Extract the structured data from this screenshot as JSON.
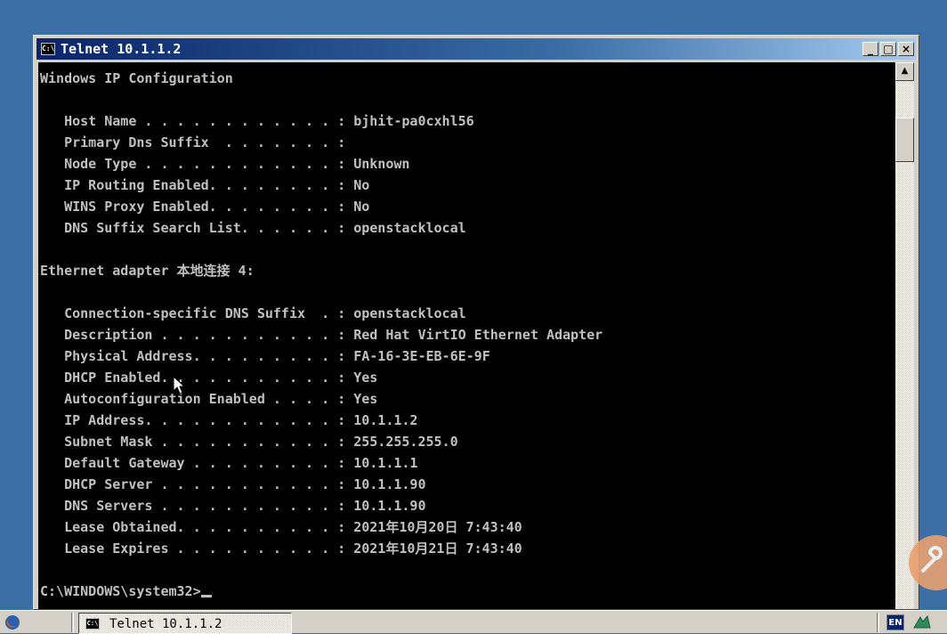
{
  "window": {
    "title": "Telnet 10.1.1.2",
    "icon_text": "C:\\",
    "minimize_glyph": "_",
    "maximize_glyph": "□",
    "close_glyph": "×"
  },
  "console": {
    "lines": [
      "Windows IP Configuration",
      "",
      "   Host Name . . . . . . . . . . . . : bjhit-pa0cxhl56",
      "   Primary Dns Suffix  . . . . . . . :",
      "   Node Type . . . . . . . . . . . . : Unknown",
      "   IP Routing Enabled. . . . . . . . : No",
      "   WINS Proxy Enabled. . . . . . . . : No",
      "   DNS Suffix Search List. . . . . . : openstacklocal",
      "",
      "Ethernet adapter 本地连接 4:",
      "",
      "   Connection-specific DNS Suffix  . : openstacklocal",
      "   Description . . . . . . . . . . . : Red Hat VirtIO Ethernet Adapter",
      "   Physical Address. . . . . . . . . : FA-16-3E-EB-6E-9F",
      "   DHCP Enabled. . . . . . . . . . . : Yes",
      "   Autoconfiguration Enabled . . . . : Yes",
      "   IP Address. . . . . . . . . . . . : 10.1.1.2",
      "   Subnet Mask . . . . . . . . . . . : 255.255.255.0",
      "   Default Gateway . . . . . . . . . : 10.1.1.1",
      "   DHCP Server . . . . . . . . . . . : 10.1.1.90",
      "   DNS Servers . . . . . . . . . . . : 10.1.1.90",
      "   Lease Obtained. . . . . . . . . . : 2021年10月20日 7:43:40",
      "   Lease Expires . . . . . . . . . . : 2021年10月21日 7:43:40",
      "",
      "C:\\WINDOWS\\system32>"
    ],
    "text_color": "#c0c0c0",
    "background": "#000000"
  },
  "scrollbar": {
    "up_glyph": "▲"
  },
  "taskbar": {
    "task_label": "Telnet 10.1.1.2",
    "task_icon_text": "C:\\",
    "language_indicator": "EN",
    "quick_launch_icon": "firefox-icon",
    "tray_icon": "ime-icon"
  },
  "colors": {
    "desktop": "#3a6ea5",
    "titlebar_start": "#0a246a",
    "titlebar_end": "#a6caf0"
  }
}
